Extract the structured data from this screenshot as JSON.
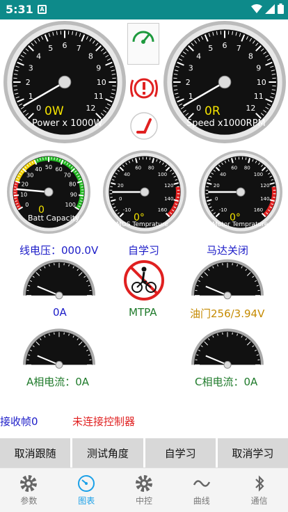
{
  "status_bar": {
    "time": "5:31",
    "notification": "A"
  },
  "gauges": {
    "power": {
      "value_text": "0W",
      "label": "Power x 1000W",
      "ticks": [
        "0",
        "1",
        "2",
        "3",
        "4",
        "5",
        "6",
        "7",
        "8",
        "9",
        "10",
        "11",
        "12"
      ]
    },
    "speed": {
      "value_text": "0R",
      "label": "Speed x1000RPM",
      "ticks": [
        "0",
        "1",
        "2",
        "3",
        "4",
        "5",
        "6",
        "7",
        "8",
        "9",
        "10",
        "11",
        "12"
      ]
    },
    "battery": {
      "value_text": "0",
      "label": "Batt Capacity",
      "ticks": [
        "0",
        "10",
        "20",
        "30",
        "40",
        "50",
        "60",
        "70",
        "80",
        "90",
        "100"
      ]
    },
    "mos_temp": {
      "value_text": "0°",
      "label": "MOS Temprature",
      "ticks": [
        "-10",
        "0",
        "20",
        "40",
        "60",
        "80",
        "100",
        "120",
        "140",
        "160"
      ]
    },
    "motor_temp": {
      "value_text": "0°",
      "label": "Motor Temprature",
      "ticks": [
        "-10",
        "0",
        "20",
        "40",
        "60",
        "80",
        "100",
        "120",
        "140",
        "160"
      ]
    }
  },
  "line_voltage": "线电压：000.0V",
  "self_learn_status": "自学习",
  "motor_status": "马达关闭",
  "current_left": "0A",
  "mtpa": "MTPA",
  "throttle": "油门256/3.94V",
  "phase_a": "A相电流：0A",
  "phase_c": "C相电流：0A",
  "recv_frames": "接收帧0",
  "controller_status": "未连接控制器",
  "buttons": [
    "取消跟随",
    "测试角度",
    "自学习",
    "取消学习"
  ],
  "tabs": [
    {
      "label": "参数",
      "icon": "gear-icon"
    },
    {
      "label": "图表",
      "icon": "gauge-icon",
      "active": true
    },
    {
      "label": "中控",
      "icon": "gear-icon"
    },
    {
      "label": "曲线",
      "icon": "wave-icon"
    },
    {
      "label": "通信",
      "icon": "bluetooth-icon"
    }
  ],
  "colors": {
    "status_bar": "#0d8a8a",
    "tab_active": "#1aa0e8",
    "value_yellow": "#f5e400"
  }
}
